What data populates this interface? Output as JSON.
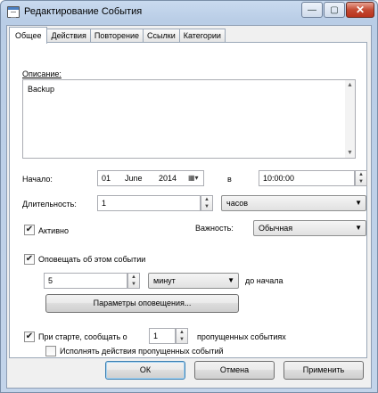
{
  "window": {
    "title": "Редактирование События"
  },
  "titlebar_buttons": {
    "minimize": "—",
    "maximize": "▢",
    "close": "✕"
  },
  "tabs": [
    "Общее",
    "Действия",
    "Повторение",
    "Ссылки",
    "Категории"
  ],
  "description": {
    "label": "Описание:",
    "value": "Backup"
  },
  "start": {
    "label": "Начало:",
    "day": "01",
    "month": "June",
    "year": "2014",
    "at_label": "в",
    "time": "10:00:00"
  },
  "duration": {
    "label": "Длительность:",
    "value": "1",
    "unit": "часов"
  },
  "active": {
    "label": "Активно",
    "checked": true
  },
  "importance": {
    "label": "Важность:",
    "value": "Обычная"
  },
  "notify": {
    "label": "Оповещать об этом событии",
    "checked": true,
    "amount": "5",
    "unit": "минут",
    "suffix": "до начала",
    "settings_button": "Параметры оповещения..."
  },
  "startup": {
    "label_before": "При старте, сообщать о",
    "checked": true,
    "value": "1",
    "label_after": "пропущенных событиях",
    "run_missed_label": "Исполнять действия пропущенных событий",
    "run_missed_checked": false
  },
  "buttons": {
    "ok": "ОК",
    "cancel": "Отмена",
    "apply": "Применить"
  },
  "icons": {
    "check": "✔",
    "spin_up": "▲",
    "spin_down": "▼",
    "dropdown": "▼",
    "calendar": "▦▾"
  }
}
